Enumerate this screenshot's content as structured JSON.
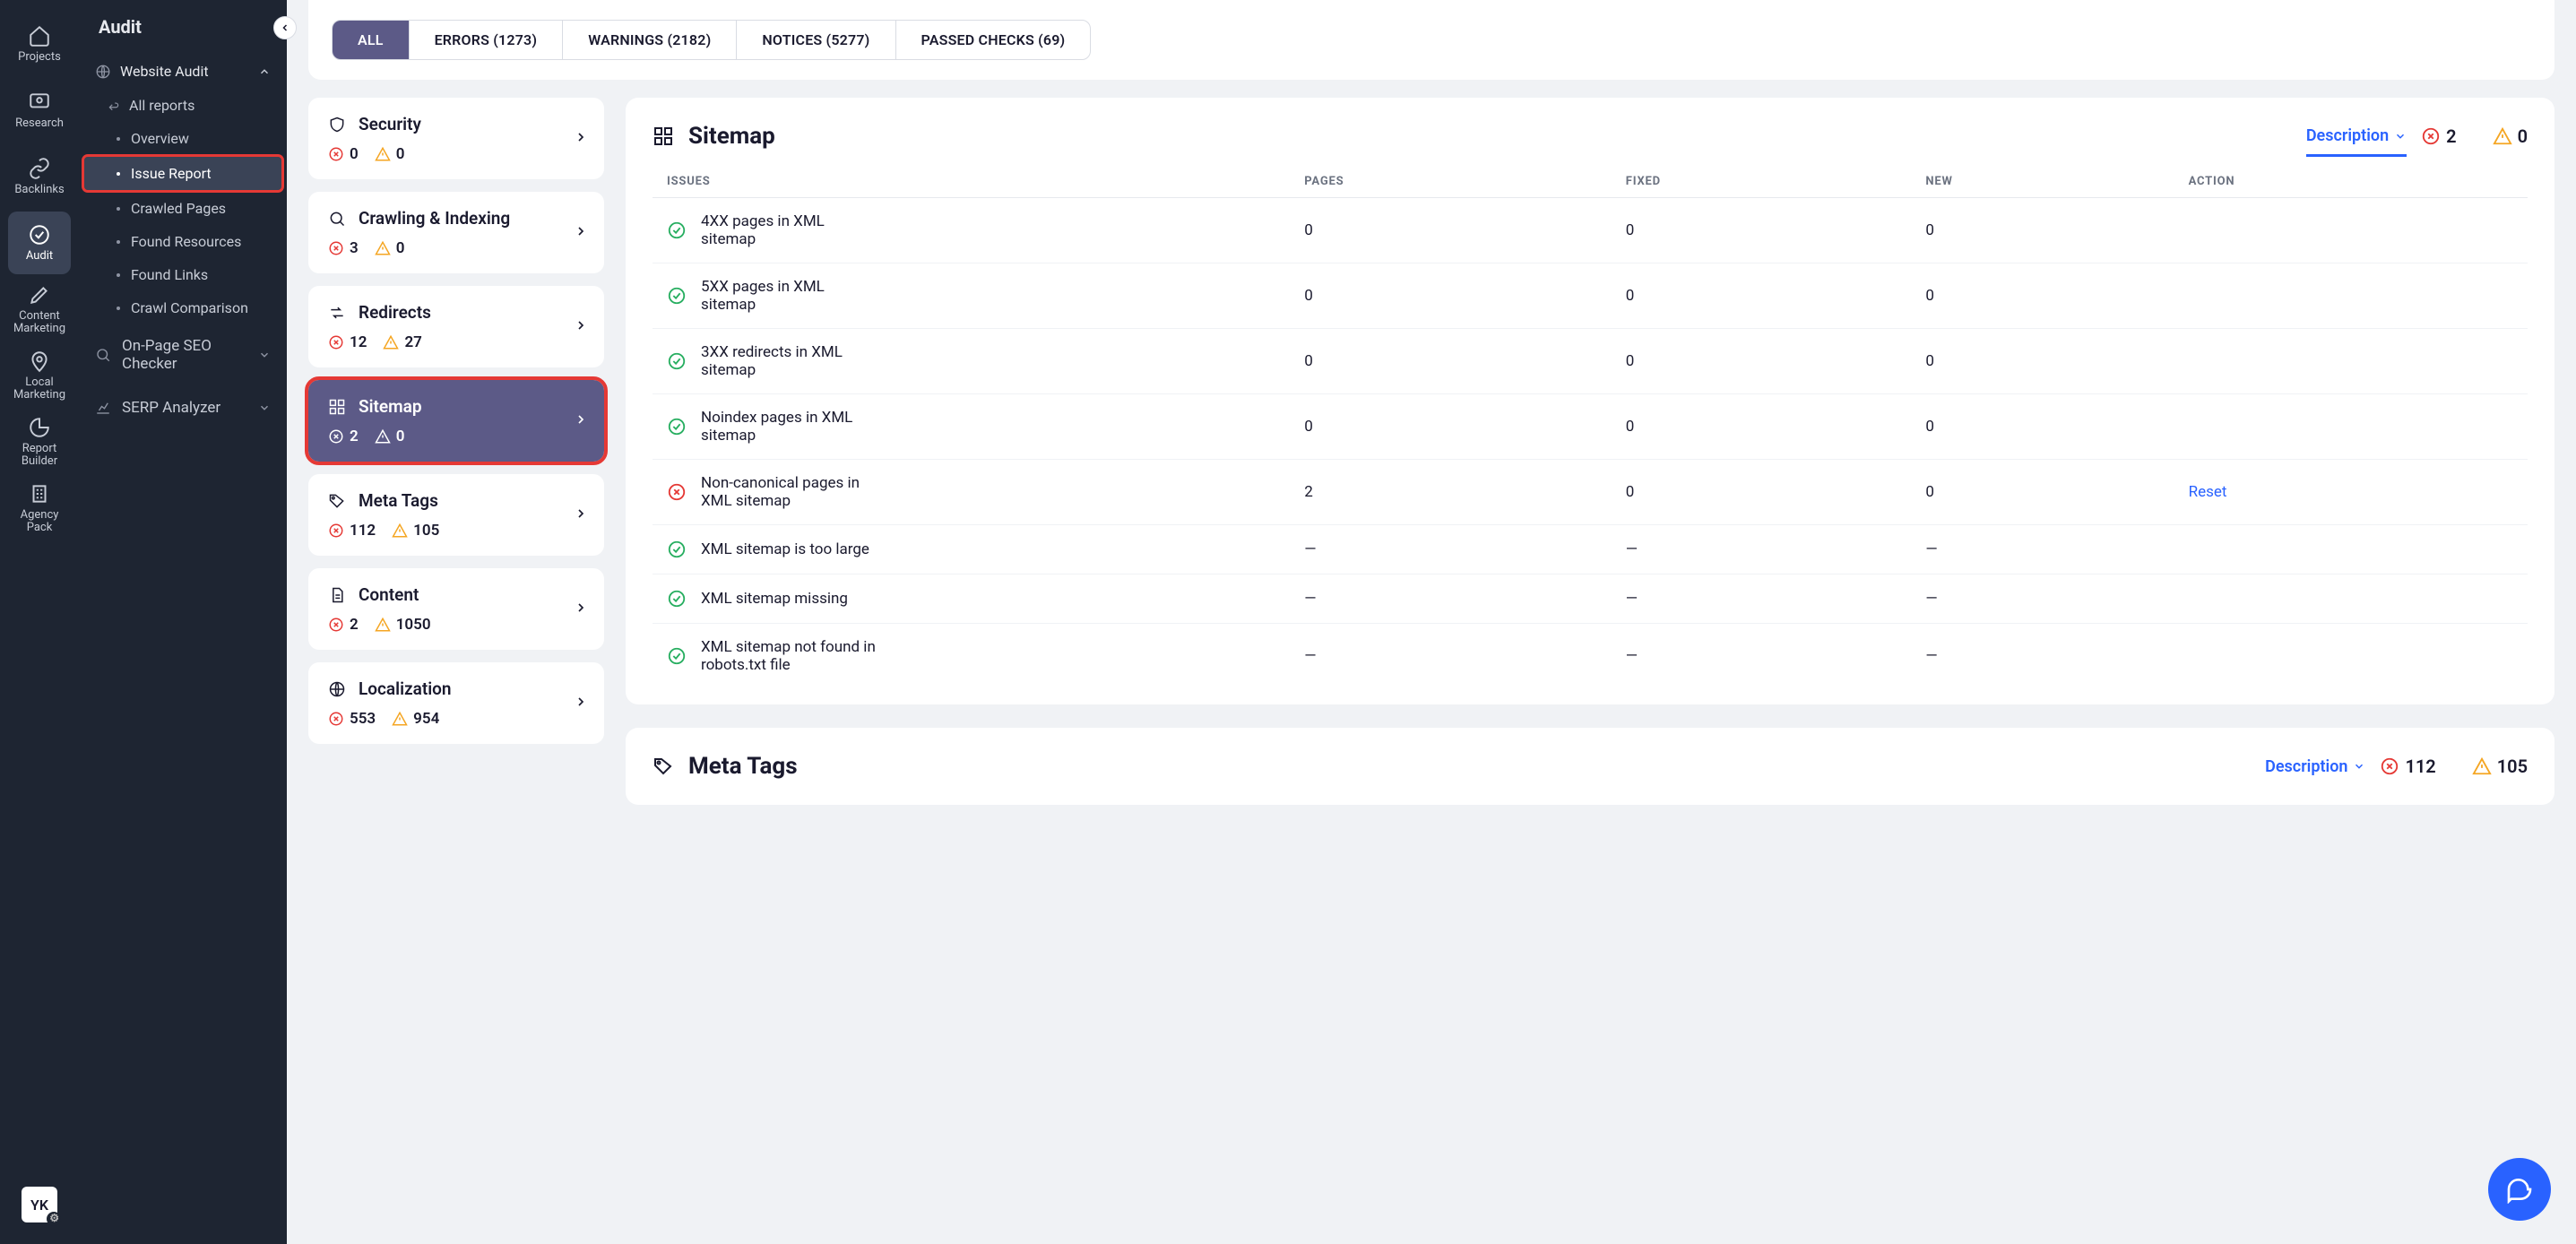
{
  "rail": {
    "items": [
      {
        "name": "projects",
        "label": "Projects"
      },
      {
        "name": "research",
        "label": "Research"
      },
      {
        "name": "backlinks",
        "label": "Backlinks"
      },
      {
        "name": "audit",
        "label": "Audit"
      },
      {
        "name": "content-marketing",
        "label": "Content\nMarketing"
      },
      {
        "name": "local-marketing",
        "label": "Local\nMarketing"
      },
      {
        "name": "report-builder",
        "label": "Report\nBuilder"
      },
      {
        "name": "agency-pack",
        "label": "Agency\nPack"
      }
    ],
    "avatar": "YK"
  },
  "sidebar": {
    "title": "Audit",
    "section": "Website Audit",
    "back": "All reports",
    "items": [
      {
        "label": "Overview"
      },
      {
        "label": "Issue Report",
        "active": true
      },
      {
        "label": "Crawled Pages"
      },
      {
        "label": "Found Resources"
      },
      {
        "label": "Found Links"
      },
      {
        "label": "Crawl Comparison"
      }
    ],
    "extra": [
      {
        "label": "On-Page SEO Checker"
      },
      {
        "label": "SERP Analyzer"
      }
    ]
  },
  "tabs": [
    {
      "key": "all",
      "label": "ALL",
      "active": true
    },
    {
      "key": "errors",
      "label": "ERRORS (1273)"
    },
    {
      "key": "warnings",
      "label": "WARNINGS (2182)"
    },
    {
      "key": "notices",
      "label": "NOTICES (5277)"
    },
    {
      "key": "passed",
      "label": "PASSED CHECKS (69)"
    }
  ],
  "categories": [
    {
      "key": "security",
      "label": "Security",
      "errors": "0",
      "warnings": "0",
      "icon": "shield"
    },
    {
      "key": "crawling",
      "label": "Crawling & Indexing",
      "errors": "3",
      "warnings": "0",
      "icon": "search"
    },
    {
      "key": "redirects",
      "label": "Redirects",
      "errors": "12",
      "warnings": "27",
      "icon": "redir"
    },
    {
      "key": "sitemap",
      "label": "Sitemap",
      "errors": "2",
      "warnings": "0",
      "icon": "grid",
      "selected": true
    },
    {
      "key": "meta",
      "label": "Meta Tags",
      "errors": "112",
      "warnings": "105",
      "icon": "tag"
    },
    {
      "key": "content",
      "label": "Content",
      "errors": "2",
      "warnings": "1050",
      "icon": "doc"
    },
    {
      "key": "localization",
      "label": "Localization",
      "errors": "553",
      "warnings": "954",
      "icon": "globe"
    }
  ],
  "panel": {
    "title": "Sitemap",
    "desc_tab": "Description",
    "errors": "2",
    "warnings": "0",
    "columns": [
      "ISSUES",
      "PAGES",
      "FIXED",
      "NEW",
      "ACTION"
    ],
    "rows": [
      {
        "status": "ok",
        "issue": "4XX pages in XML sitemap",
        "pages": "0",
        "fixed": "0",
        "new": "0",
        "action": ""
      },
      {
        "status": "ok",
        "issue": "5XX pages in XML sitemap",
        "pages": "0",
        "fixed": "0",
        "new": "0",
        "action": ""
      },
      {
        "status": "ok",
        "issue": "3XX redirects in XML sitemap",
        "pages": "0",
        "fixed": "0",
        "new": "0",
        "action": ""
      },
      {
        "status": "ok",
        "issue": "Noindex pages in XML sitemap",
        "pages": "0",
        "fixed": "0",
        "new": "0",
        "action": ""
      },
      {
        "status": "err",
        "issue": "Non-canonical pages in XML sitemap",
        "pages": "2",
        "fixed": "0",
        "new": "0",
        "action": "Reset"
      },
      {
        "status": "ok",
        "issue": "XML sitemap is too large",
        "pages": "—",
        "fixed": "—",
        "new": "—",
        "action": ""
      },
      {
        "status": "ok",
        "issue": "XML sitemap missing",
        "pages": "—",
        "fixed": "—",
        "new": "—",
        "action": ""
      },
      {
        "status": "ok",
        "issue": "XML sitemap not found in robots.txt file",
        "pages": "—",
        "fixed": "—",
        "new": "—",
        "action": ""
      }
    ]
  },
  "panel2": {
    "title": "Meta Tags",
    "desc_tab": "Description",
    "errors": "112",
    "warnings": "105"
  }
}
